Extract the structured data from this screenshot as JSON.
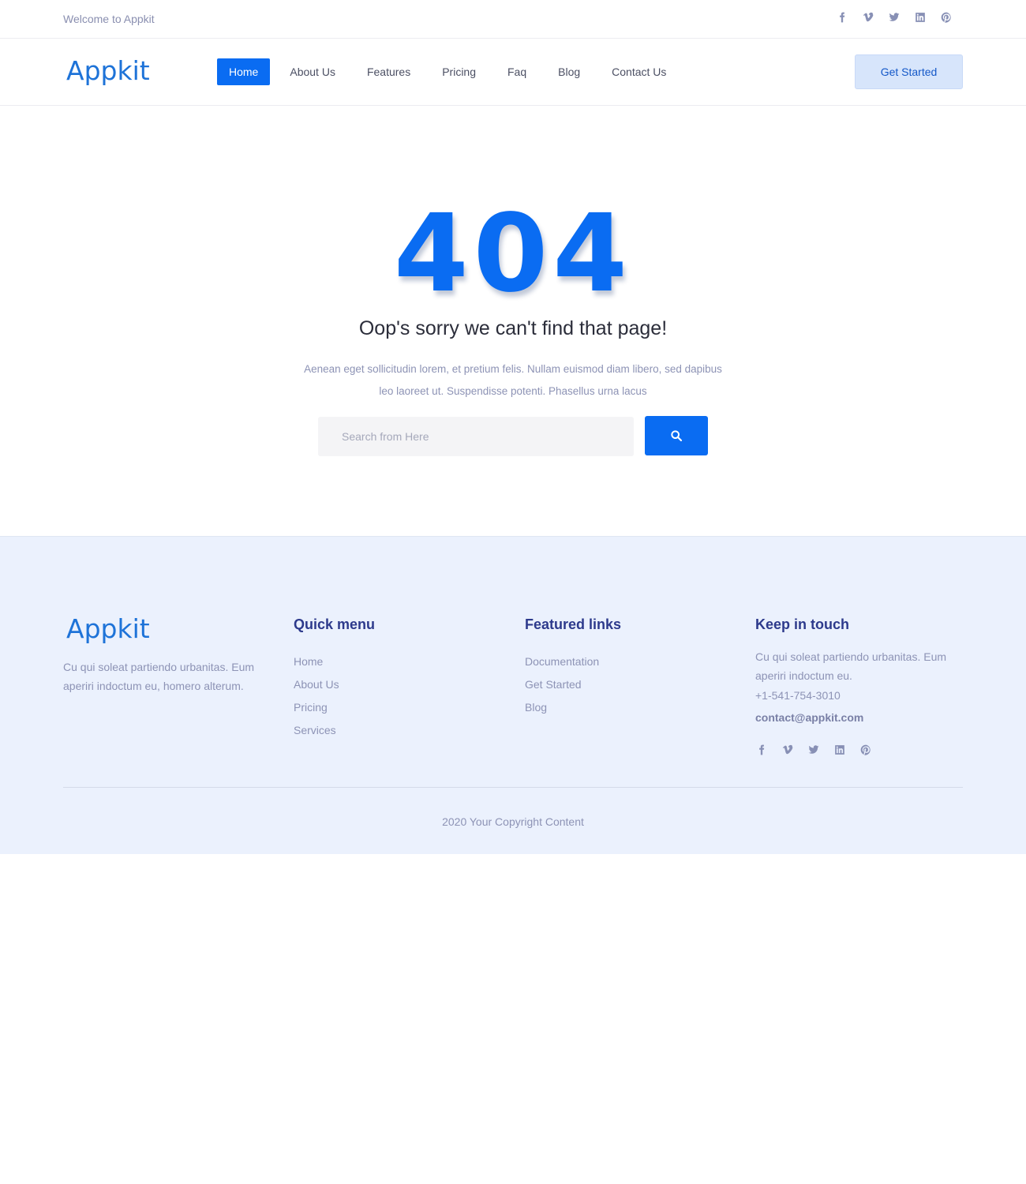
{
  "topbar": {
    "welcome": "Welcome to Appkit",
    "social": [
      "facebook-icon",
      "vimeo-icon",
      "twitter-icon",
      "linkedin-icon",
      "pinterest-icon"
    ]
  },
  "navbar": {
    "logo": "Appkit",
    "menu": [
      {
        "label": "Home",
        "active": true
      },
      {
        "label": "About Us"
      },
      {
        "label": "Features"
      },
      {
        "label": "Pricing"
      },
      {
        "label": "Faq"
      },
      {
        "label": "Blog"
      },
      {
        "label": "Contact Us"
      }
    ],
    "cta": "Get Started"
  },
  "error": {
    "code": "404",
    "title": "Oop's sorry we can't find that page!",
    "description": "Aenean eget sollicitudin lorem, et pretium felis. Nullam euismod diam libero, sed dapibus leo laoreet ut. Suspendisse potenti. Phasellus urna lacus",
    "search_placeholder": "Search from Here",
    "search_button_icon": "search-icon"
  },
  "footer": {
    "logo": "Appkit",
    "about": "Cu qui soleat partiendo urbanitas. Eum aperiri indoctum eu, homero alterum.",
    "quick_menu": {
      "title": "Quick menu",
      "links": [
        "Home",
        "About Us",
        "Pricing",
        "Services"
      ]
    },
    "featured": {
      "title": "Featured links",
      "links": [
        "Documentation",
        "Get Started",
        "Blog"
      ]
    },
    "touch": {
      "title": "Keep in touch",
      "text": "Cu qui soleat partiendo urbanitas. Eum aperiri indoctum eu.",
      "phone": "+1-541-754-3010",
      "email": "contact@appkit.com"
    },
    "copyright": "2020 Your Copyright Content"
  },
  "colors": {
    "primary": "#0a6cf2",
    "footer_bg": "#ebf1fd",
    "heading": "#2d3a8c",
    "muted": "#8d93b5"
  }
}
